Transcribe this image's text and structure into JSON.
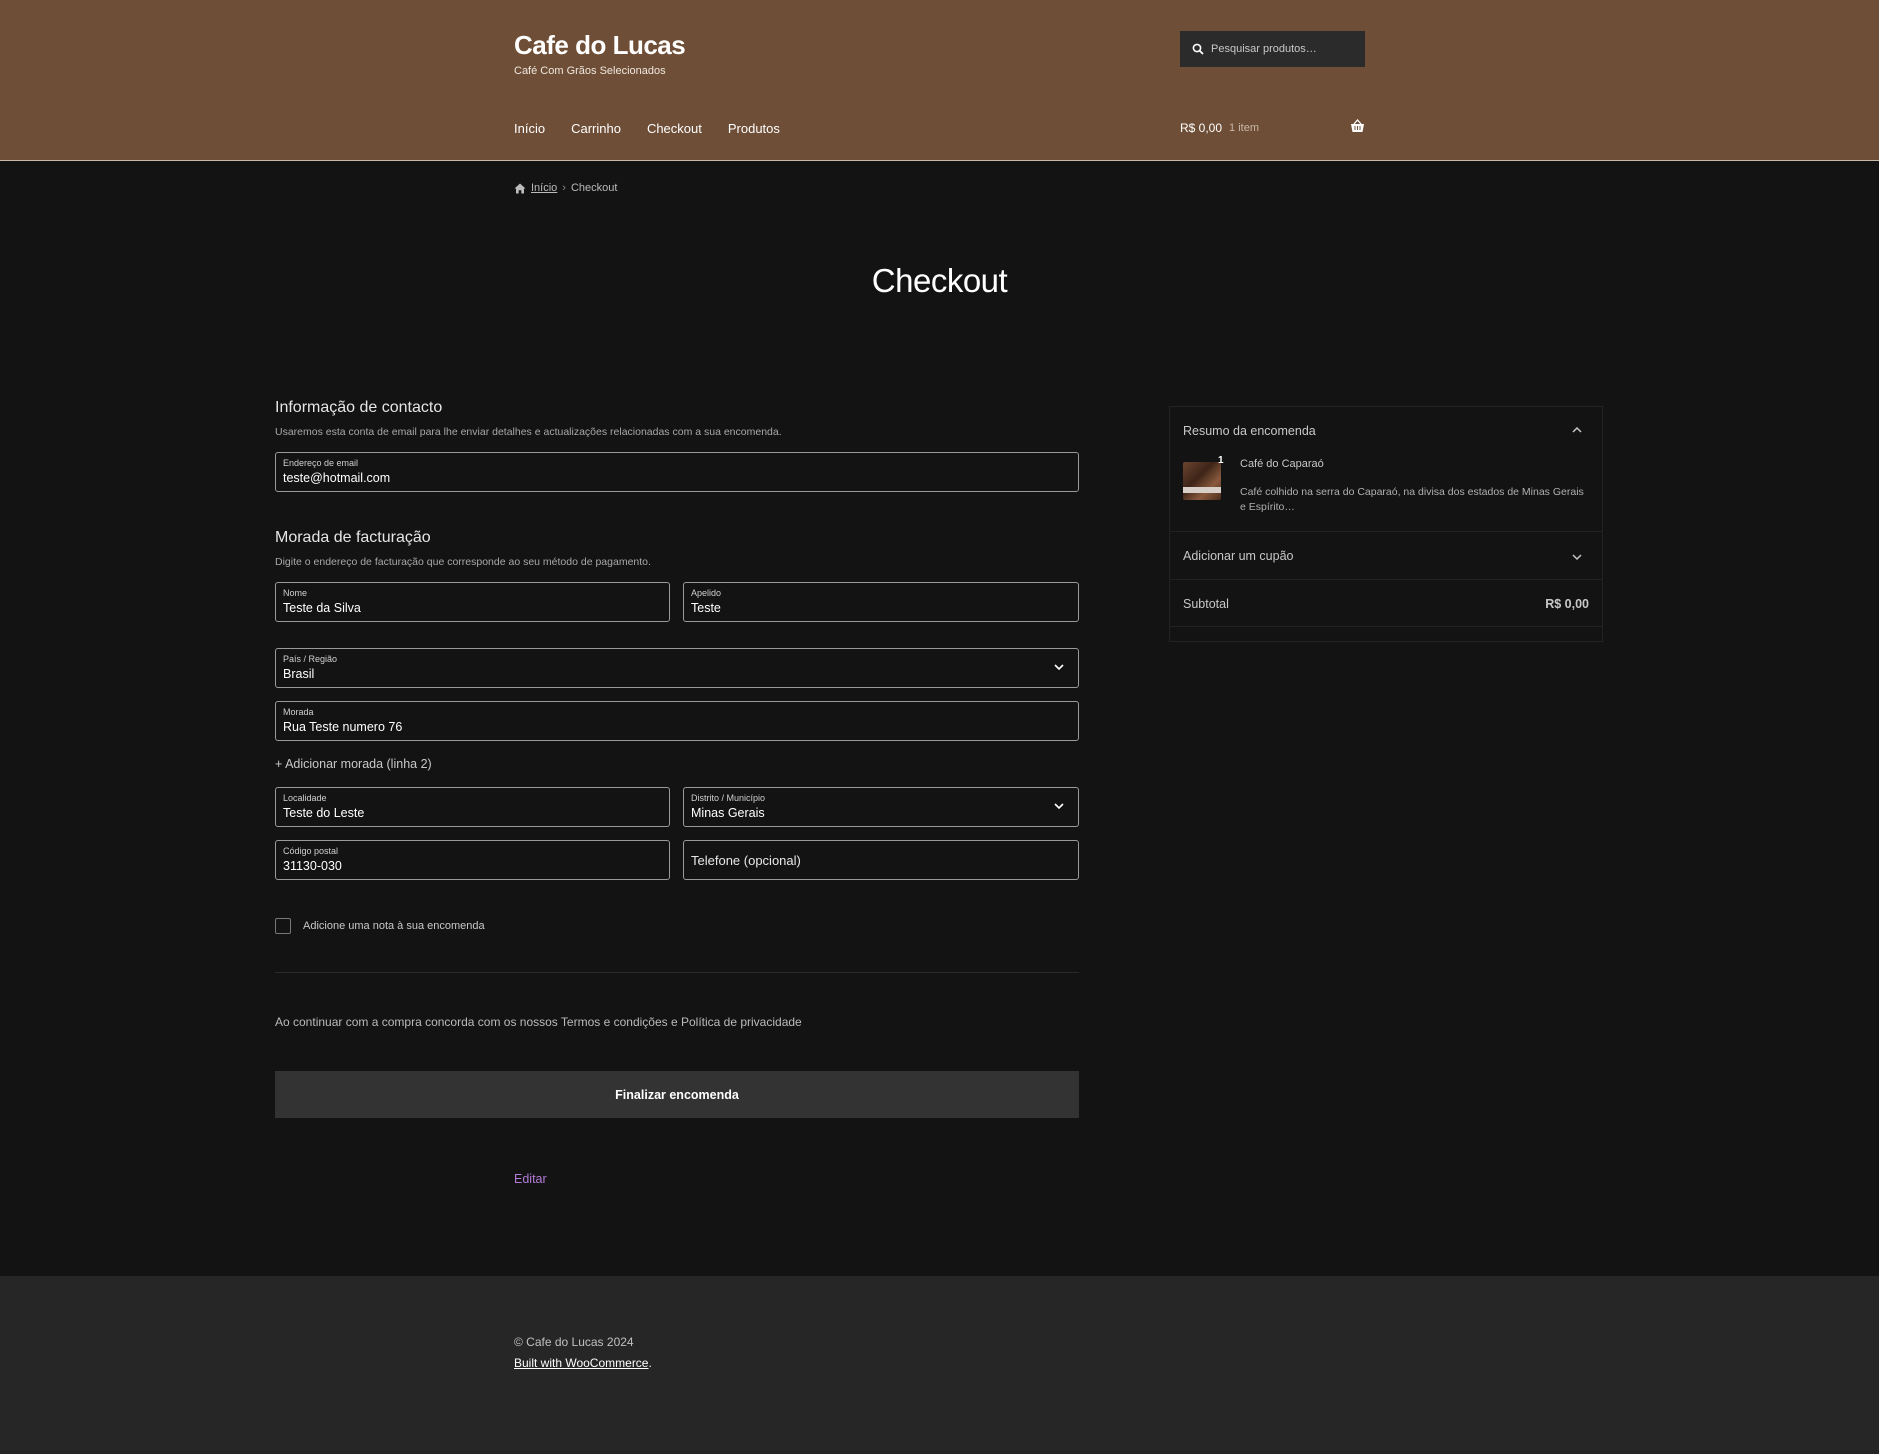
{
  "header": {
    "site_title": "Cafe do Lucas",
    "tagline": "Café Com Grãos Selecionados",
    "search_placeholder": "Pesquisar produtos…",
    "nav": [
      "Início",
      "Carrinho",
      "Checkout",
      "Produtos"
    ],
    "cart_amount": "R$ 0,00",
    "cart_count": "1 item",
    "background_color": "#6e4e36"
  },
  "breadcrumb": {
    "home": "Início",
    "separator": "›",
    "current": "Checkout"
  },
  "page_title": "Checkout",
  "contact": {
    "title": "Informação de contacto",
    "description": "Usaremos esta conta de email para lhe enviar detalhes e actualizações relacionadas com a sua encomenda.",
    "email_label": "Endereço de email",
    "email_value": "teste@hotmail.com"
  },
  "billing": {
    "title": "Morada de facturação",
    "description": "Digite o endereço de facturação que corresponde ao seu método de pagamento.",
    "first_name_label": "Nome",
    "first_name_value": "Teste da Silva",
    "last_name_label": "Apelido",
    "last_name_value": "Teste",
    "country_label": "País / Região",
    "country_value": "Brasil",
    "address_label": "Morada",
    "address_value": "Rua Teste numero 76",
    "add_line2": "+ Adicionar morada (linha 2)",
    "city_label": "Localidade",
    "city_value": "Teste do Leste",
    "state_label": "Distrito / Município",
    "state_value": "Minas Gerais",
    "postcode_label": "Código postal",
    "postcode_value": "31130-030",
    "phone_placeholder": "Telefone (opcional)"
  },
  "order_note": "Adicione uma nota à sua encomenda",
  "terms": "Ao continuar com a compra concorda com os nossos Termos e condições e Política de privacidade",
  "place_order": "Finalizar encomenda",
  "edit_link": "Editar",
  "summary": {
    "title": "Resumo da encomenda",
    "item_qty": "1",
    "item_name": "Café do Caparaó",
    "item_desc": "Café colhido na serra do Caparaó, na divisa dos estados de Minas Gerais e Espírito…",
    "coupon": "Adicionar um cupão",
    "subtotal_label": "Subtotal",
    "subtotal_value": "R$ 0,00"
  },
  "footer": {
    "copyright": "© Cafe do Lucas 2024",
    "built_with": "Built with WooCommerce"
  },
  "colors": {
    "accent_link": "#b37bd6",
    "button_bg": "#333333",
    "page_bg": "#131313"
  }
}
